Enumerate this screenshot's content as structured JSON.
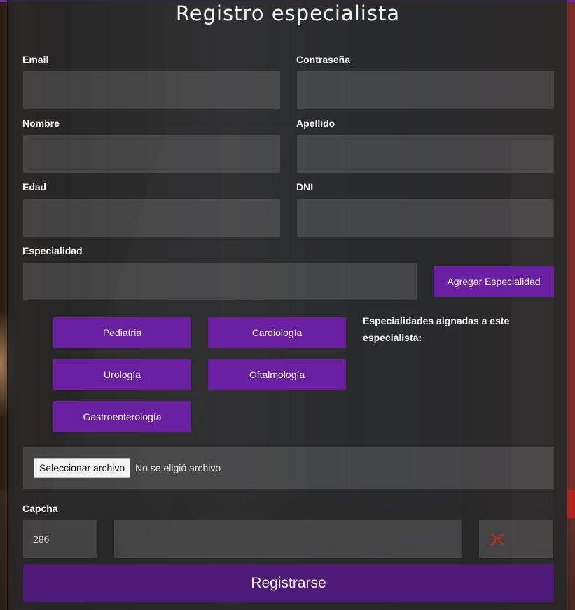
{
  "form": {
    "title": "Registro especialista",
    "fields": {
      "email": {
        "label": "Email",
        "value": ""
      },
      "password": {
        "label": "Contraseña",
        "value": ""
      },
      "first_name": {
        "label": "Nombre",
        "value": ""
      },
      "last_name": {
        "label": "Apellido",
        "value": ""
      },
      "age": {
        "label": "Edad",
        "value": ""
      },
      "dni": {
        "label": "DNI",
        "value": ""
      },
      "specialty": {
        "label": "Especialidad",
        "value": ""
      }
    },
    "add_specialty_label": "Agregar Especialidad",
    "specialties": [
      "Pediatria",
      "Cardiología",
      "Urología",
      "Oftalmología",
      "Gastroenterología"
    ],
    "assigned_note": "Especialidades aignadas a este especialista:",
    "file_upload": {
      "button_label": "Seleccionar archivo",
      "status": "No se eligió archivo"
    },
    "captcha": {
      "label": "Capcha",
      "code": "286",
      "answer": "",
      "status_icon": "close-icon"
    },
    "submit_label": "Registrarse"
  },
  "colors": {
    "accent": "#6a1fa0",
    "submit": "#4e1a78",
    "error": "#d9331f"
  }
}
